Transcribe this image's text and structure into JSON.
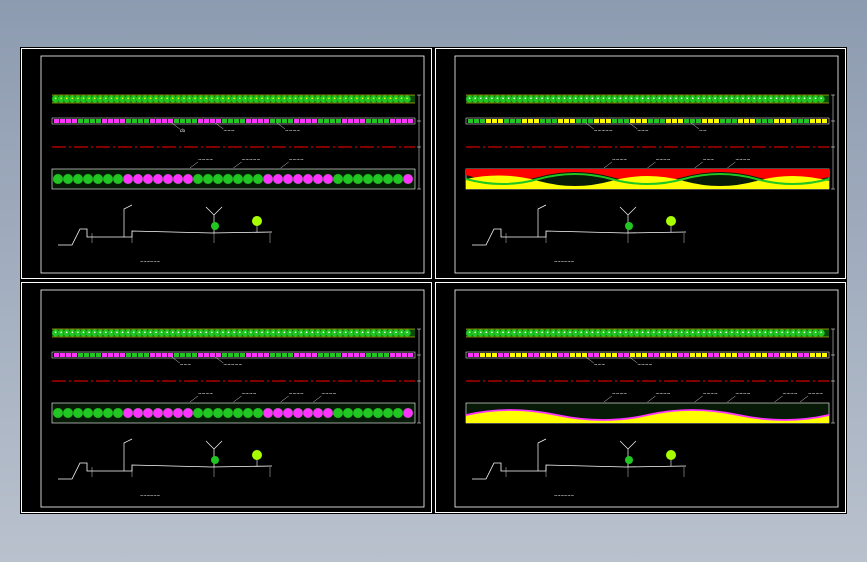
{
  "colors": {
    "background": "#000000",
    "frame": "#ffffff",
    "tree_green": "#22c622",
    "lime": "#a8ff00",
    "magenta": "#ff33ff",
    "yellow": "#ffff00",
    "red": "#ff0000",
    "section_line": "#ffffff"
  },
  "sheets": [
    {
      "id": "top-left",
      "hedge_pattern": "yellow-dots",
      "middle_strip": "magenta-green",
      "lower_band": "green-magenta-blocks",
      "labels_top": [
        "cb",
        "~~~",
        "~~~~"
      ],
      "labels_bottom": [
        "~~~~",
        "~~~~~",
        "~~~~"
      ],
      "section_caption": "~~~~~~"
    },
    {
      "id": "top-right",
      "hedge_pattern": "white-dots",
      "middle_strip": "green-yellow",
      "lower_band": "wave-red-yellow",
      "labels_top": [
        "~~~~~",
        "~~~",
        "~~"
      ],
      "labels_bottom": [
        "~~~~",
        "~~~~",
        "~~~",
        "~~~~"
      ],
      "section_caption": "~~~~~~"
    },
    {
      "id": "bottom-left",
      "hedge_pattern": "white-dots",
      "middle_strip": "magenta-green",
      "lower_band": "green-magenta-blocks",
      "labels_top": [
        "~~~",
        "~~~~~"
      ],
      "labels_bottom": [
        "~~~~",
        "~~~~",
        "~~~~",
        "~~~~"
      ],
      "section_caption": "~~~~~~"
    },
    {
      "id": "bottom-right",
      "hedge_pattern": "white-dots",
      "middle_strip": "yellow-magenta",
      "lower_band": "yellow-magenta-wave",
      "labels_top": [
        "~~~",
        "~~~~"
      ],
      "labels_bottom": [
        "~~~~",
        "~~~~",
        "~~~~",
        "~~~~",
        "~~~~",
        "~~~~"
      ],
      "section_caption": "~~~~~~"
    }
  ]
}
